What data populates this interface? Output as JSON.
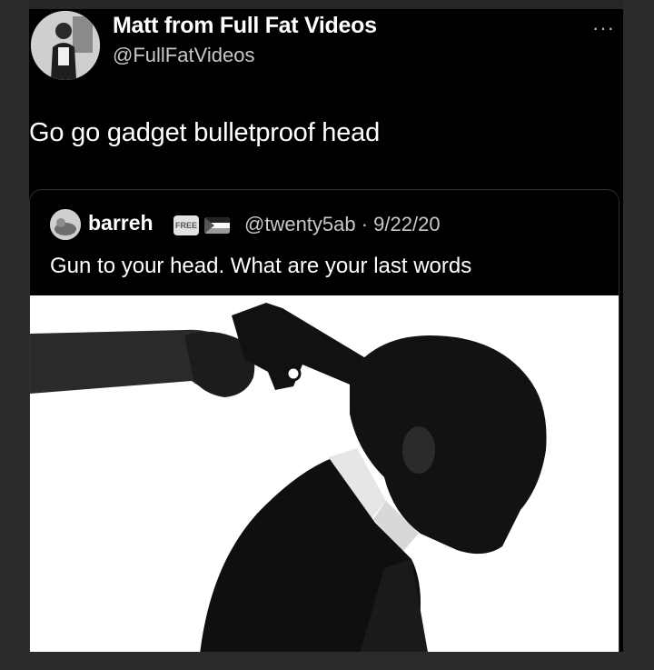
{
  "tweet": {
    "display_name": "Matt from Full Fat Videos",
    "handle": "@FullFatVideos",
    "more_icon": "···",
    "text": "Go go gadget bulletproof head"
  },
  "quote": {
    "display_name": "barreh",
    "badge_text": "FREE",
    "handle_date": "@twenty5ab · 9/22/20",
    "text": "Gun to your head. What are your last words"
  },
  "icons": {
    "avatar": "user-avatar",
    "quote_avatar": "quoted-user-avatar",
    "flag": "flag-icon",
    "badge": "free-badge-icon",
    "more": "more-options-icon"
  }
}
